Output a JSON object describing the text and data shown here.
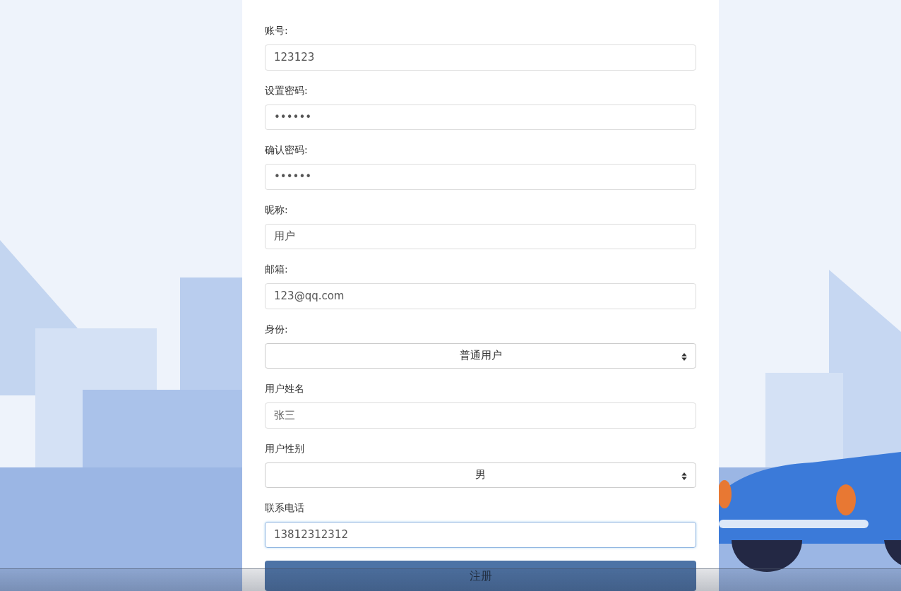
{
  "form": {
    "fields": [
      {
        "label": "账号:",
        "kind": "text",
        "value": "123123",
        "focused": false
      },
      {
        "label": "设置密码:",
        "kind": "text",
        "value": "••••••",
        "focused": false
      },
      {
        "label": "确认密码:",
        "kind": "text",
        "value": "••••••",
        "focused": false
      },
      {
        "label": "昵称:",
        "kind": "text",
        "value": "用户",
        "focused": false
      },
      {
        "label": "邮箱:",
        "kind": "text",
        "value": "123@qq.com",
        "focused": false
      },
      {
        "label": "身份:",
        "kind": "select",
        "value": "普通用户",
        "focused": false
      },
      {
        "label": "用户姓名",
        "kind": "text",
        "value": "张三",
        "focused": false
      },
      {
        "label": "用户性别",
        "kind": "select",
        "value": "男",
        "focused": false
      },
      {
        "label": "联系电话",
        "kind": "text",
        "value": "13812312312",
        "focused": true
      }
    ],
    "submit": "注册"
  }
}
